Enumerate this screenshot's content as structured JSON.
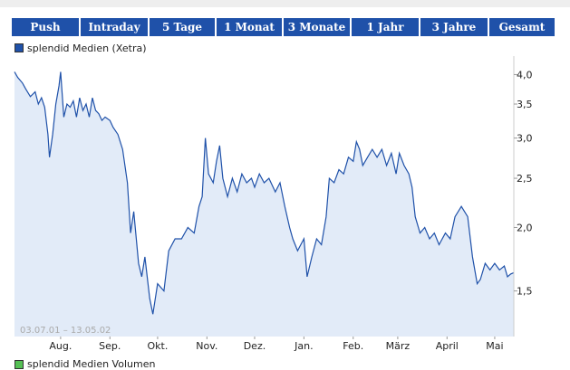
{
  "tabs": [
    {
      "label": "Push"
    },
    {
      "label": "Intraday"
    },
    {
      "label": "5 Tage"
    },
    {
      "label": "1 Monat"
    },
    {
      "label": "3 Monate"
    },
    {
      "label": "1 Jahr"
    },
    {
      "label": "3 Jahre"
    },
    {
      "label": "Gesamt"
    }
  ],
  "colors": {
    "tab_bg": "#1f51a9",
    "line": "#1f51a9",
    "fill": "#e2ebf8",
    "volume": "#55c055"
  },
  "legend": {
    "series_label": "splendid Medien (Xetra)"
  },
  "legend_bottom": {
    "label": "splendid Medien Volumen"
  },
  "date_range": "03.07.01 – 13.05.02",
  "chart_data": {
    "type": "area",
    "series": [
      {
        "name": "splendid Medien (Xetra)"
      }
    ],
    "y_scale": "log",
    "ylim": [
      1.22,
      4.35
    ],
    "yticks": [
      "4,0",
      "3,5",
      "3,0",
      "2,5",
      "2,0",
      "1,5"
    ],
    "ytick_values": [
      4.0,
      3.5,
      3.0,
      2.5,
      2.0,
      1.5
    ],
    "xtick_labels": [
      "Aug.",
      "Sep.",
      "Okt.",
      "Nov.",
      "Dez.",
      "Jan.",
      "Feb.",
      "März",
      "April",
      "Mai"
    ],
    "xtick_dates": [
      "2001-08-01",
      "2001-09-01",
      "2001-10-01",
      "2001-11-01",
      "2001-12-01",
      "2002-01-01",
      "2002-02-01",
      "2002-03-01",
      "2002-04-01",
      "2002-05-01"
    ],
    "xlim": [
      "2001-07-03",
      "2002-05-13"
    ],
    "points": [
      [
        "2001-07-03",
        4.05
      ],
      [
        "2001-07-05",
        3.95
      ],
      [
        "2001-07-08",
        3.85
      ],
      [
        "2001-07-10",
        3.75
      ],
      [
        "2001-07-13",
        3.62
      ],
      [
        "2001-07-16",
        3.7
      ],
      [
        "2001-07-18",
        3.5
      ],
      [
        "2001-07-20",
        3.6
      ],
      [
        "2001-07-22",
        3.45
      ],
      [
        "2001-07-24",
        3.05
      ],
      [
        "2001-07-25",
        2.75
      ],
      [
        "2001-07-27",
        3.05
      ],
      [
        "2001-07-29",
        3.5
      ],
      [
        "2001-07-31",
        3.8
      ],
      [
        "2001-08-01",
        4.05
      ],
      [
        "2001-08-03",
        3.3
      ],
      [
        "2001-08-05",
        3.5
      ],
      [
        "2001-08-07",
        3.45
      ],
      [
        "2001-08-09",
        3.55
      ],
      [
        "2001-08-11",
        3.3
      ],
      [
        "2001-08-13",
        3.6
      ],
      [
        "2001-08-15",
        3.4
      ],
      [
        "2001-08-17",
        3.5
      ],
      [
        "2001-08-19",
        3.3
      ],
      [
        "2001-08-21",
        3.6
      ],
      [
        "2001-08-23",
        3.4
      ],
      [
        "2001-08-25",
        3.35
      ],
      [
        "2001-08-27",
        3.25
      ],
      [
        "2001-08-29",
        3.3
      ],
      [
        "2001-09-01",
        3.25
      ],
      [
        "2001-09-03",
        3.15
      ],
      [
        "2001-09-06",
        3.05
      ],
      [
        "2001-09-09",
        2.85
      ],
      [
        "2001-09-12",
        2.45
      ],
      [
        "2001-09-14",
        1.95
      ],
      [
        "2001-09-16",
        2.15
      ],
      [
        "2001-09-19",
        1.7
      ],
      [
        "2001-09-21",
        1.6
      ],
      [
        "2001-09-23",
        1.75
      ],
      [
        "2001-09-26",
        1.45
      ],
      [
        "2001-09-28",
        1.35
      ],
      [
        "2001-10-01",
        1.55
      ],
      [
        "2001-10-05",
        1.5
      ],
      [
        "2001-10-08",
        1.8
      ],
      [
        "2001-10-12",
        1.9
      ],
      [
        "2001-10-16",
        1.9
      ],
      [
        "2001-10-20",
        2.0
      ],
      [
        "2001-10-24",
        1.95
      ],
      [
        "2001-10-27",
        2.2
      ],
      [
        "2001-10-29",
        2.3
      ],
      [
        "2001-10-31",
        3.0
      ],
      [
        "2001-11-02",
        2.55
      ],
      [
        "2001-11-05",
        2.45
      ],
      [
        "2001-11-07",
        2.7
      ],
      [
        "2001-11-09",
        2.9
      ],
      [
        "2001-11-11",
        2.5
      ],
      [
        "2001-11-14",
        2.3
      ],
      [
        "2001-11-17",
        2.5
      ],
      [
        "2001-11-20",
        2.35
      ],
      [
        "2001-11-23",
        2.55
      ],
      [
        "2001-11-26",
        2.45
      ],
      [
        "2001-11-29",
        2.5
      ],
      [
        "2001-12-01",
        2.4
      ],
      [
        "2001-12-04",
        2.55
      ],
      [
        "2001-12-07",
        2.45
      ],
      [
        "2001-12-10",
        2.5
      ],
      [
        "2001-12-14",
        2.35
      ],
      [
        "2001-12-17",
        2.45
      ],
      [
        "2001-12-20",
        2.2
      ],
      [
        "2001-12-23",
        2.0
      ],
      [
        "2001-12-25",
        1.9
      ],
      [
        "2001-12-28",
        1.8
      ],
      [
        "2001-12-30",
        1.85
      ],
      [
        "2002-01-01",
        1.9
      ],
      [
        "2002-01-03",
        1.6
      ],
      [
        "2002-01-06",
        1.75
      ],
      [
        "2002-01-09",
        1.9
      ],
      [
        "2002-01-12",
        1.85
      ],
      [
        "2002-01-15",
        2.1
      ],
      [
        "2002-01-17",
        2.5
      ],
      [
        "2002-01-20",
        2.45
      ],
      [
        "2002-01-23",
        2.6
      ],
      [
        "2002-01-26",
        2.55
      ],
      [
        "2002-01-29",
        2.75
      ],
      [
        "2002-02-01",
        2.7
      ],
      [
        "2002-02-03",
        2.95
      ],
      [
        "2002-02-05",
        2.85
      ],
      [
        "2002-02-07",
        2.65
      ],
      [
        "2002-02-10",
        2.75
      ],
      [
        "2002-02-13",
        2.85
      ],
      [
        "2002-02-16",
        2.75
      ],
      [
        "2002-02-19",
        2.85
      ],
      [
        "2002-02-22",
        2.65
      ],
      [
        "2002-02-25",
        2.8
      ],
      [
        "2002-02-28",
        2.55
      ],
      [
        "2002-03-02",
        2.8
      ],
      [
        "2002-03-05",
        2.65
      ],
      [
        "2002-03-08",
        2.55
      ],
      [
        "2002-03-10",
        2.4
      ],
      [
        "2002-03-12",
        2.1
      ],
      [
        "2002-03-15",
        1.95
      ],
      [
        "2002-03-18",
        2.0
      ],
      [
        "2002-03-21",
        1.9
      ],
      [
        "2002-03-24",
        1.95
      ],
      [
        "2002-03-27",
        1.85
      ],
      [
        "2002-03-31",
        1.95
      ],
      [
        "2002-04-03",
        1.9
      ],
      [
        "2002-04-06",
        2.1
      ],
      [
        "2002-04-10",
        2.2
      ],
      [
        "2002-04-14",
        2.1
      ],
      [
        "2002-04-17",
        1.75
      ],
      [
        "2002-04-20",
        1.55
      ],
      [
        "2002-04-22",
        1.58
      ],
      [
        "2002-04-25",
        1.7
      ],
      [
        "2002-04-28",
        1.65
      ],
      [
        "2002-05-01",
        1.7
      ],
      [
        "2002-05-04",
        1.65
      ],
      [
        "2002-05-07",
        1.68
      ],
      [
        "2002-05-09",
        1.6
      ],
      [
        "2002-05-11",
        1.62
      ],
      [
        "2002-05-13",
        1.63
      ]
    ],
    "grid": false
  }
}
